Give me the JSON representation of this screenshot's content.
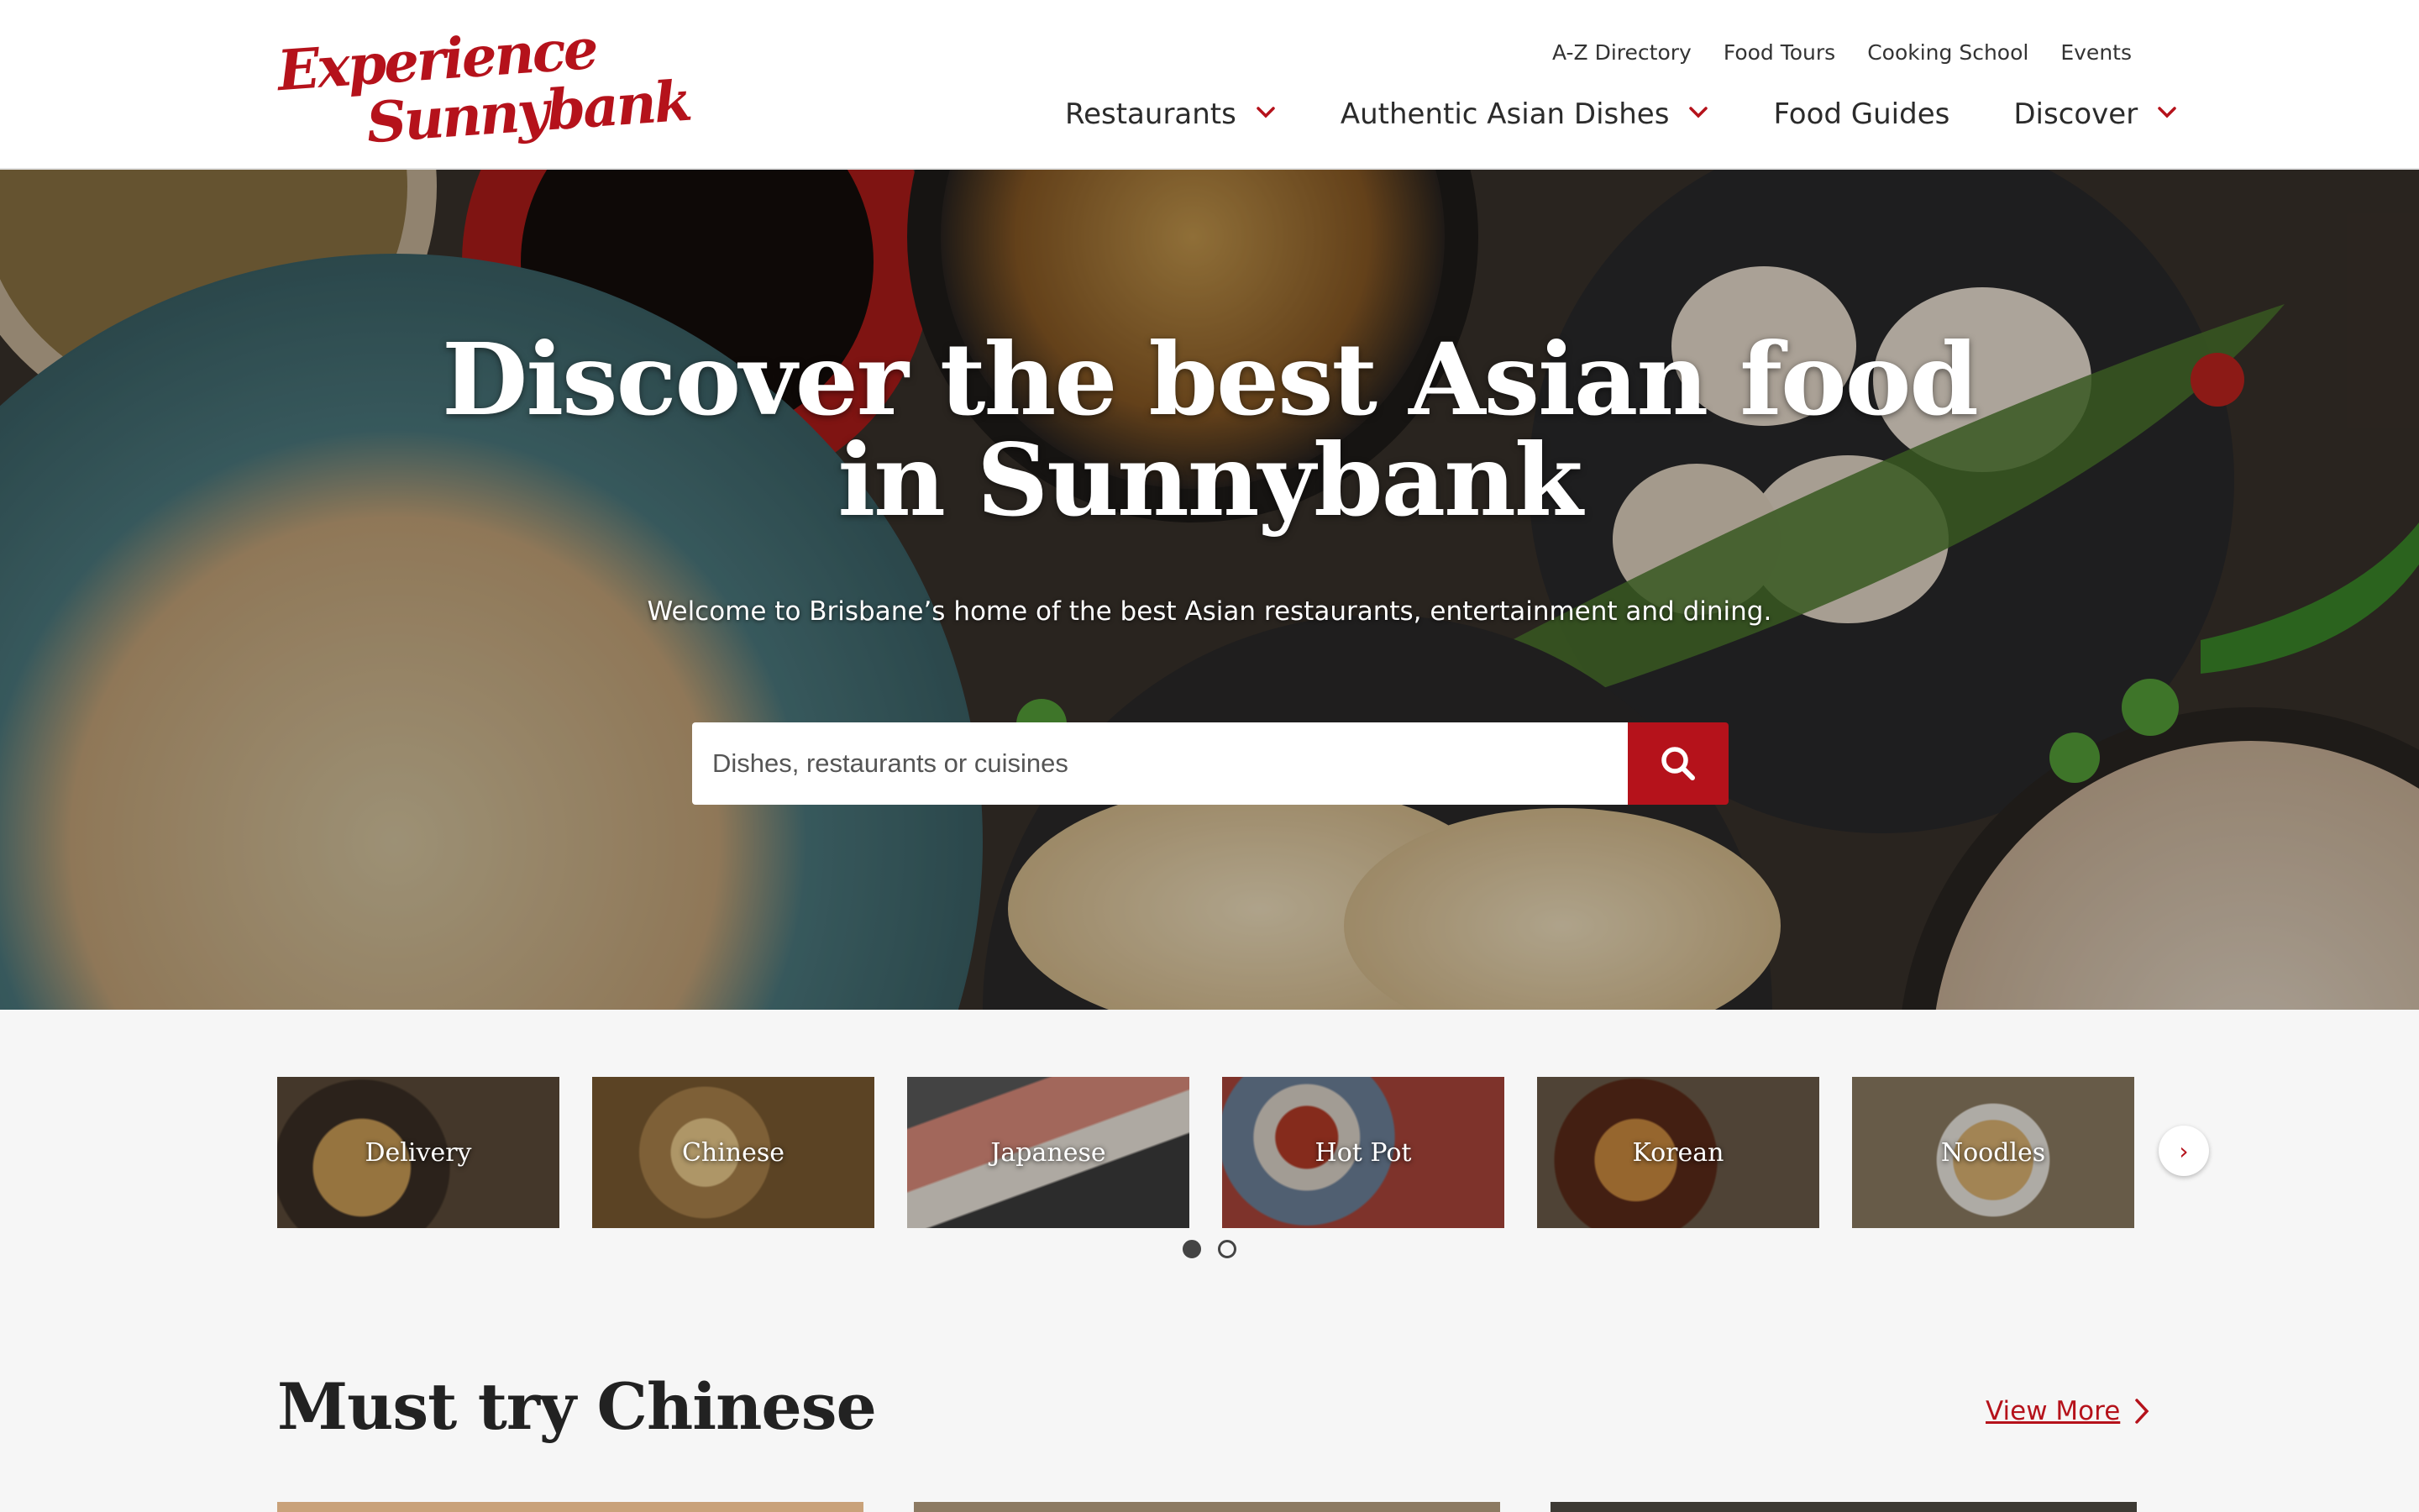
{
  "brand": {
    "line1": "Experience",
    "line2": "Sunnybank",
    "color": "#b5121b"
  },
  "utility_nav": [
    "A-Z Directory",
    "Food Tours",
    "Cooking School",
    "Events"
  ],
  "main_nav": [
    {
      "label": "Restaurants",
      "has_dropdown": true
    },
    {
      "label": "Authentic Asian Dishes",
      "has_dropdown": true
    },
    {
      "label": "Food Guides",
      "has_dropdown": false
    },
    {
      "label": "Discover",
      "has_dropdown": true
    }
  ],
  "hero": {
    "title_line1": "Discover the best Asian food",
    "title_line2": "in Sunnybank",
    "subtitle": "Welcome to Brisbane’s home of the best Asian restaurants, entertainment and dining.",
    "search_placeholder": "Dishes, restaurants or cuisines",
    "search_icon": "search-icon"
  },
  "categories": [
    "Delivery",
    "Chinese",
    "Japanese",
    "Hot Pot",
    "Korean",
    "Noodles"
  ],
  "carousel": {
    "next_icon": "›",
    "pages": 2,
    "active_page": 1
  },
  "section": {
    "title": "Must try Chinese",
    "view_more": "View More"
  }
}
